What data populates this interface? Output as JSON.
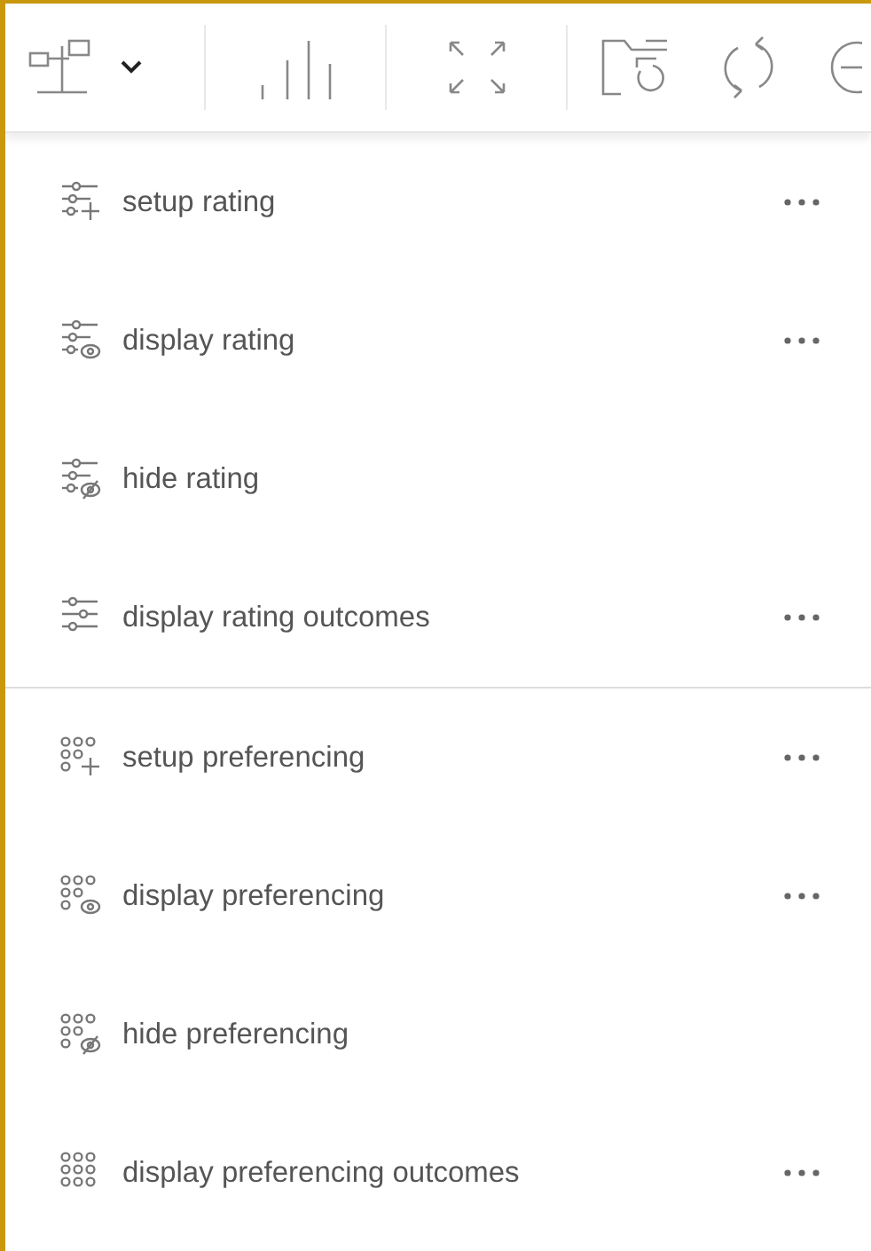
{
  "sections": [
    {
      "kind": "sliders",
      "items": [
        {
          "label": "setup rating",
          "kind": "setup",
          "more": true
        },
        {
          "label": "display rating",
          "kind": "display",
          "more": true
        },
        {
          "label": "hide rating",
          "kind": "hide",
          "more": false
        },
        {
          "label": "display rating outcomes",
          "kind": "outcomes",
          "more": true
        }
      ]
    },
    {
      "kind": "dots",
      "items": [
        {
          "label": "setup preferencing",
          "kind": "setup",
          "more": true
        },
        {
          "label": "display preferencing",
          "kind": "display",
          "more": true
        },
        {
          "label": "hide preferencing",
          "kind": "hide",
          "more": false
        },
        {
          "label": "display preferencing outcomes",
          "kind": "outcomes",
          "more": true
        }
      ]
    }
  ]
}
